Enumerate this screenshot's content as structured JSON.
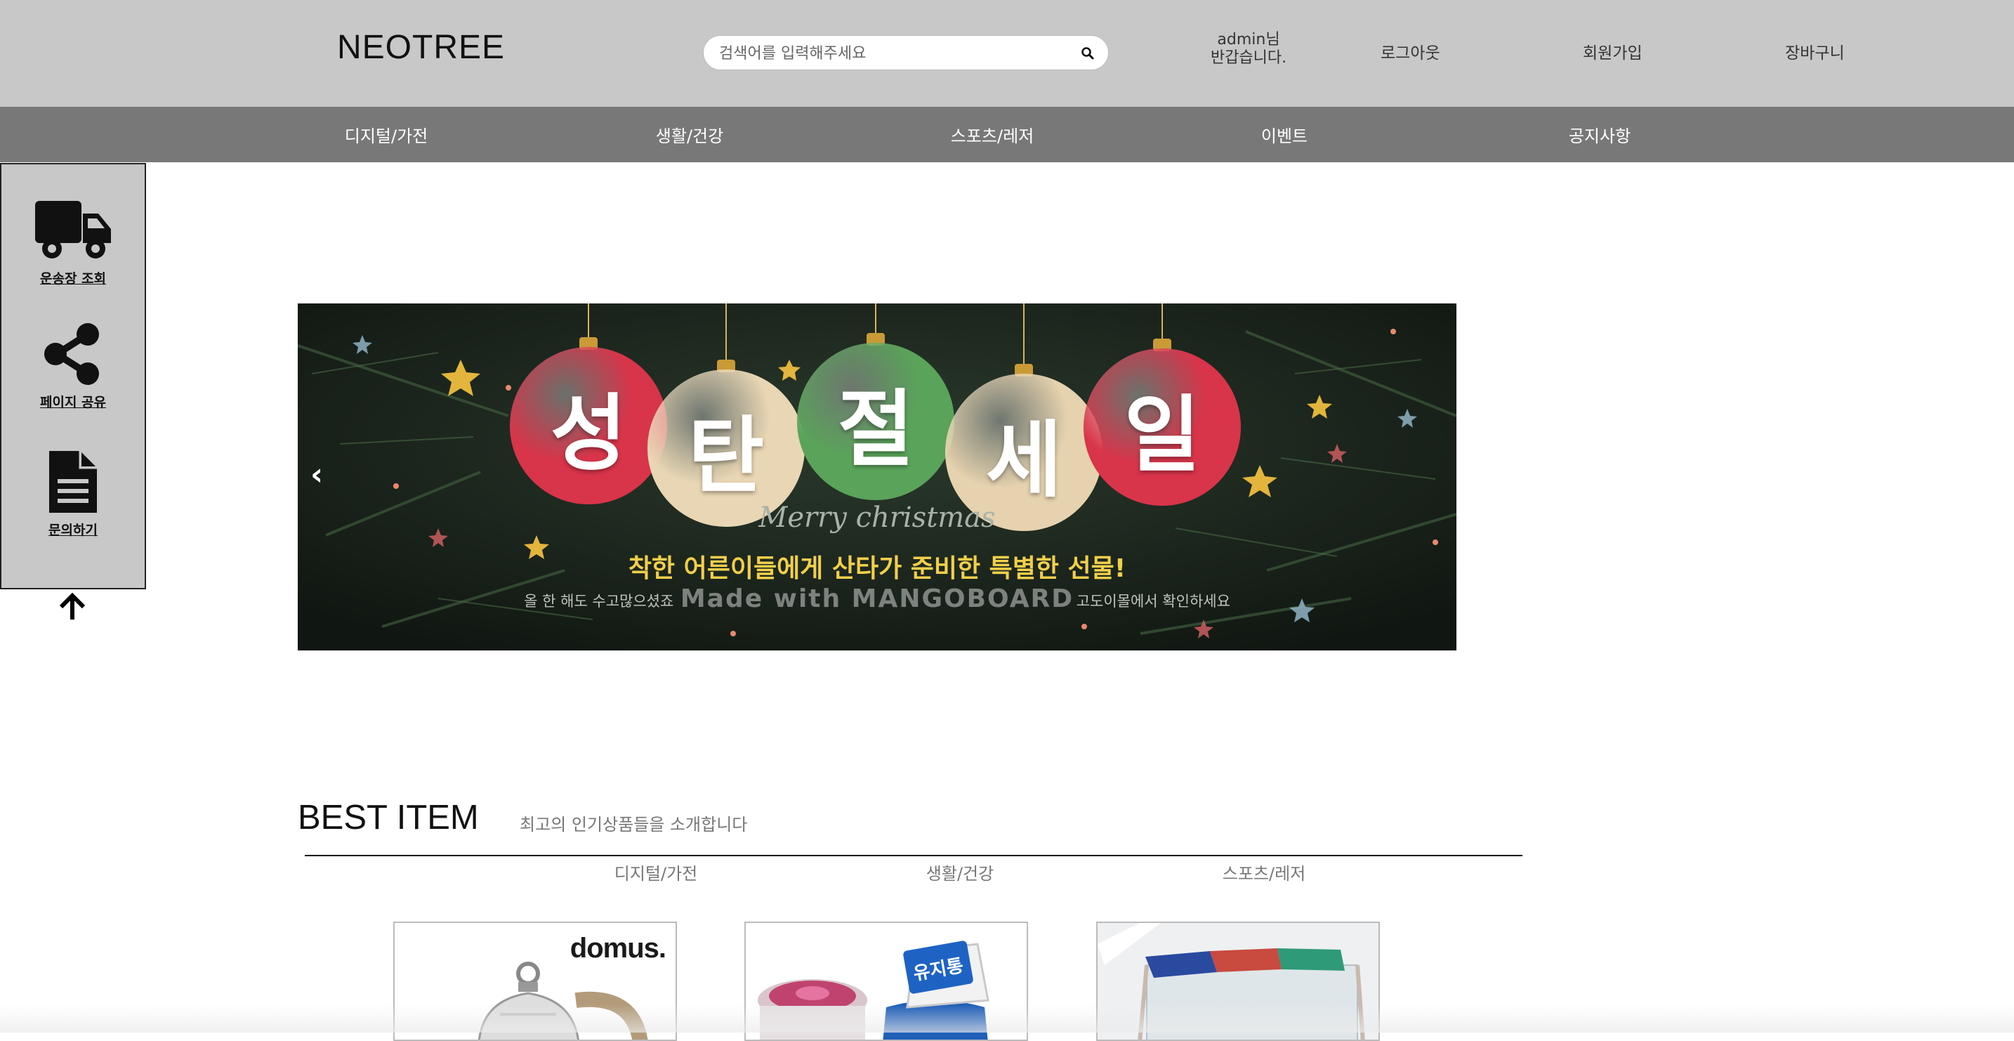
{
  "header": {
    "logo": "NEOTREE",
    "search_placeholder": "검색어를 입력해주세요",
    "greeting_line1": "admin님",
    "greeting_line2": "반갑습니다.",
    "logout": "로그아웃",
    "signup": "회원가입",
    "cart": "장바구니"
  },
  "nav": {
    "items": [
      "디지털/가전",
      "생활/건강",
      "스포츠/레저",
      "이벤트",
      "공지사항"
    ]
  },
  "quick_menu": {
    "items": [
      {
        "label": "운송장 조회",
        "icon": "truck-icon"
      },
      {
        "label": "페이지 공유",
        "icon": "share-icon"
      },
      {
        "label": "문의하기",
        "icon": "document-icon"
      }
    ],
    "to_top_icon": "arrow-up-icon"
  },
  "banner": {
    "ornaments": [
      {
        "char": "성",
        "color": "#d8344a"
      },
      {
        "char": "탄",
        "color": "#e9d6b4"
      },
      {
        "char": "절",
        "color": "#5aa35a"
      },
      {
        "char": "세",
        "color": "#e6d2ae"
      },
      {
        "char": "일",
        "color": "#d8344a"
      }
    ],
    "merry": "Merry christmas",
    "promo": "착한 어른이들에게 산타가 준비한 특별한 선물!",
    "subpromo": "올 한 해도 수고많으셨죠",
    "subpromo_right": "고도이몰에서 확인하세요",
    "watermark": "Made with MANGOBOARD",
    "prev_label": "‹"
  },
  "best": {
    "title": "BEST ITEM",
    "subtitle": "최고의 인기상품들을 소개합니다",
    "categories": [
      "디지털/가전",
      "생활/건강",
      "스포츠/레저"
    ],
    "products": [
      {
        "brand": "domus."
      },
      {
        "label": "유지통"
      },
      {
        "label": ""
      }
    ]
  }
}
